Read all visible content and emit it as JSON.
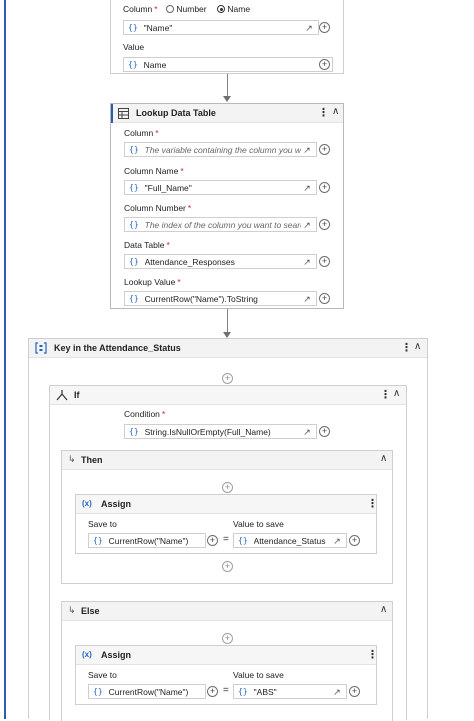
{
  "top_assign": {
    "column_label": "Column",
    "radio_number": "Number",
    "radio_name": "Name",
    "column_value": "\"Name\"",
    "value_label": "Value",
    "value_value": "Name"
  },
  "lookup": {
    "title": "Lookup Data Table",
    "column_label": "Column",
    "column_placeholder": "The variable containing the column you wa",
    "column_name_label": "Column Name",
    "column_name_value": "\"Full_Name\"",
    "column_number_label": "Column Number",
    "column_number_placeholder": "The index of the column you want to searc",
    "data_table_label": "Data Table",
    "data_table_value": "Attendance_Responses",
    "lookup_value_label": "Lookup Value",
    "lookup_value_value": "CurrentRow(\"Name\").ToString"
  },
  "sequence": {
    "title": "Key in the Attendance_Status"
  },
  "if_block": {
    "title": "If",
    "condition_label": "Condition",
    "condition_value": "String.IsNullOrEmpty(Full_Name)",
    "then_label": "Then",
    "else_label": "Else"
  },
  "assign_then": {
    "title": "Assign",
    "badge": "(x)",
    "save_to_label": "Save to",
    "value_to_save_label": "Value to save",
    "save_to_value": "CurrentRow(\"Name\")",
    "value_to_save_value": "Attendance_Status",
    "eq": "="
  },
  "assign_else": {
    "title": "Assign",
    "badge": "(x)",
    "save_to_label": "Save to",
    "value_to_save_label": "Value to save",
    "save_to_value": "CurrentRow(\"Name\")",
    "value_to_save_value": "\"ABS\"",
    "eq": "="
  },
  "glyphs": {
    "brace": "{}",
    "required": "*",
    "plus": "+",
    "kebab": "⋮",
    "collapse": "≈",
    "chevron_up": "^",
    "expand": "↗",
    "branch_arrow": "↳"
  },
  "colors": {
    "accent_blue": "#2266c2",
    "left_rail": "#2b5bb5",
    "required_red": "#c4262e"
  }
}
